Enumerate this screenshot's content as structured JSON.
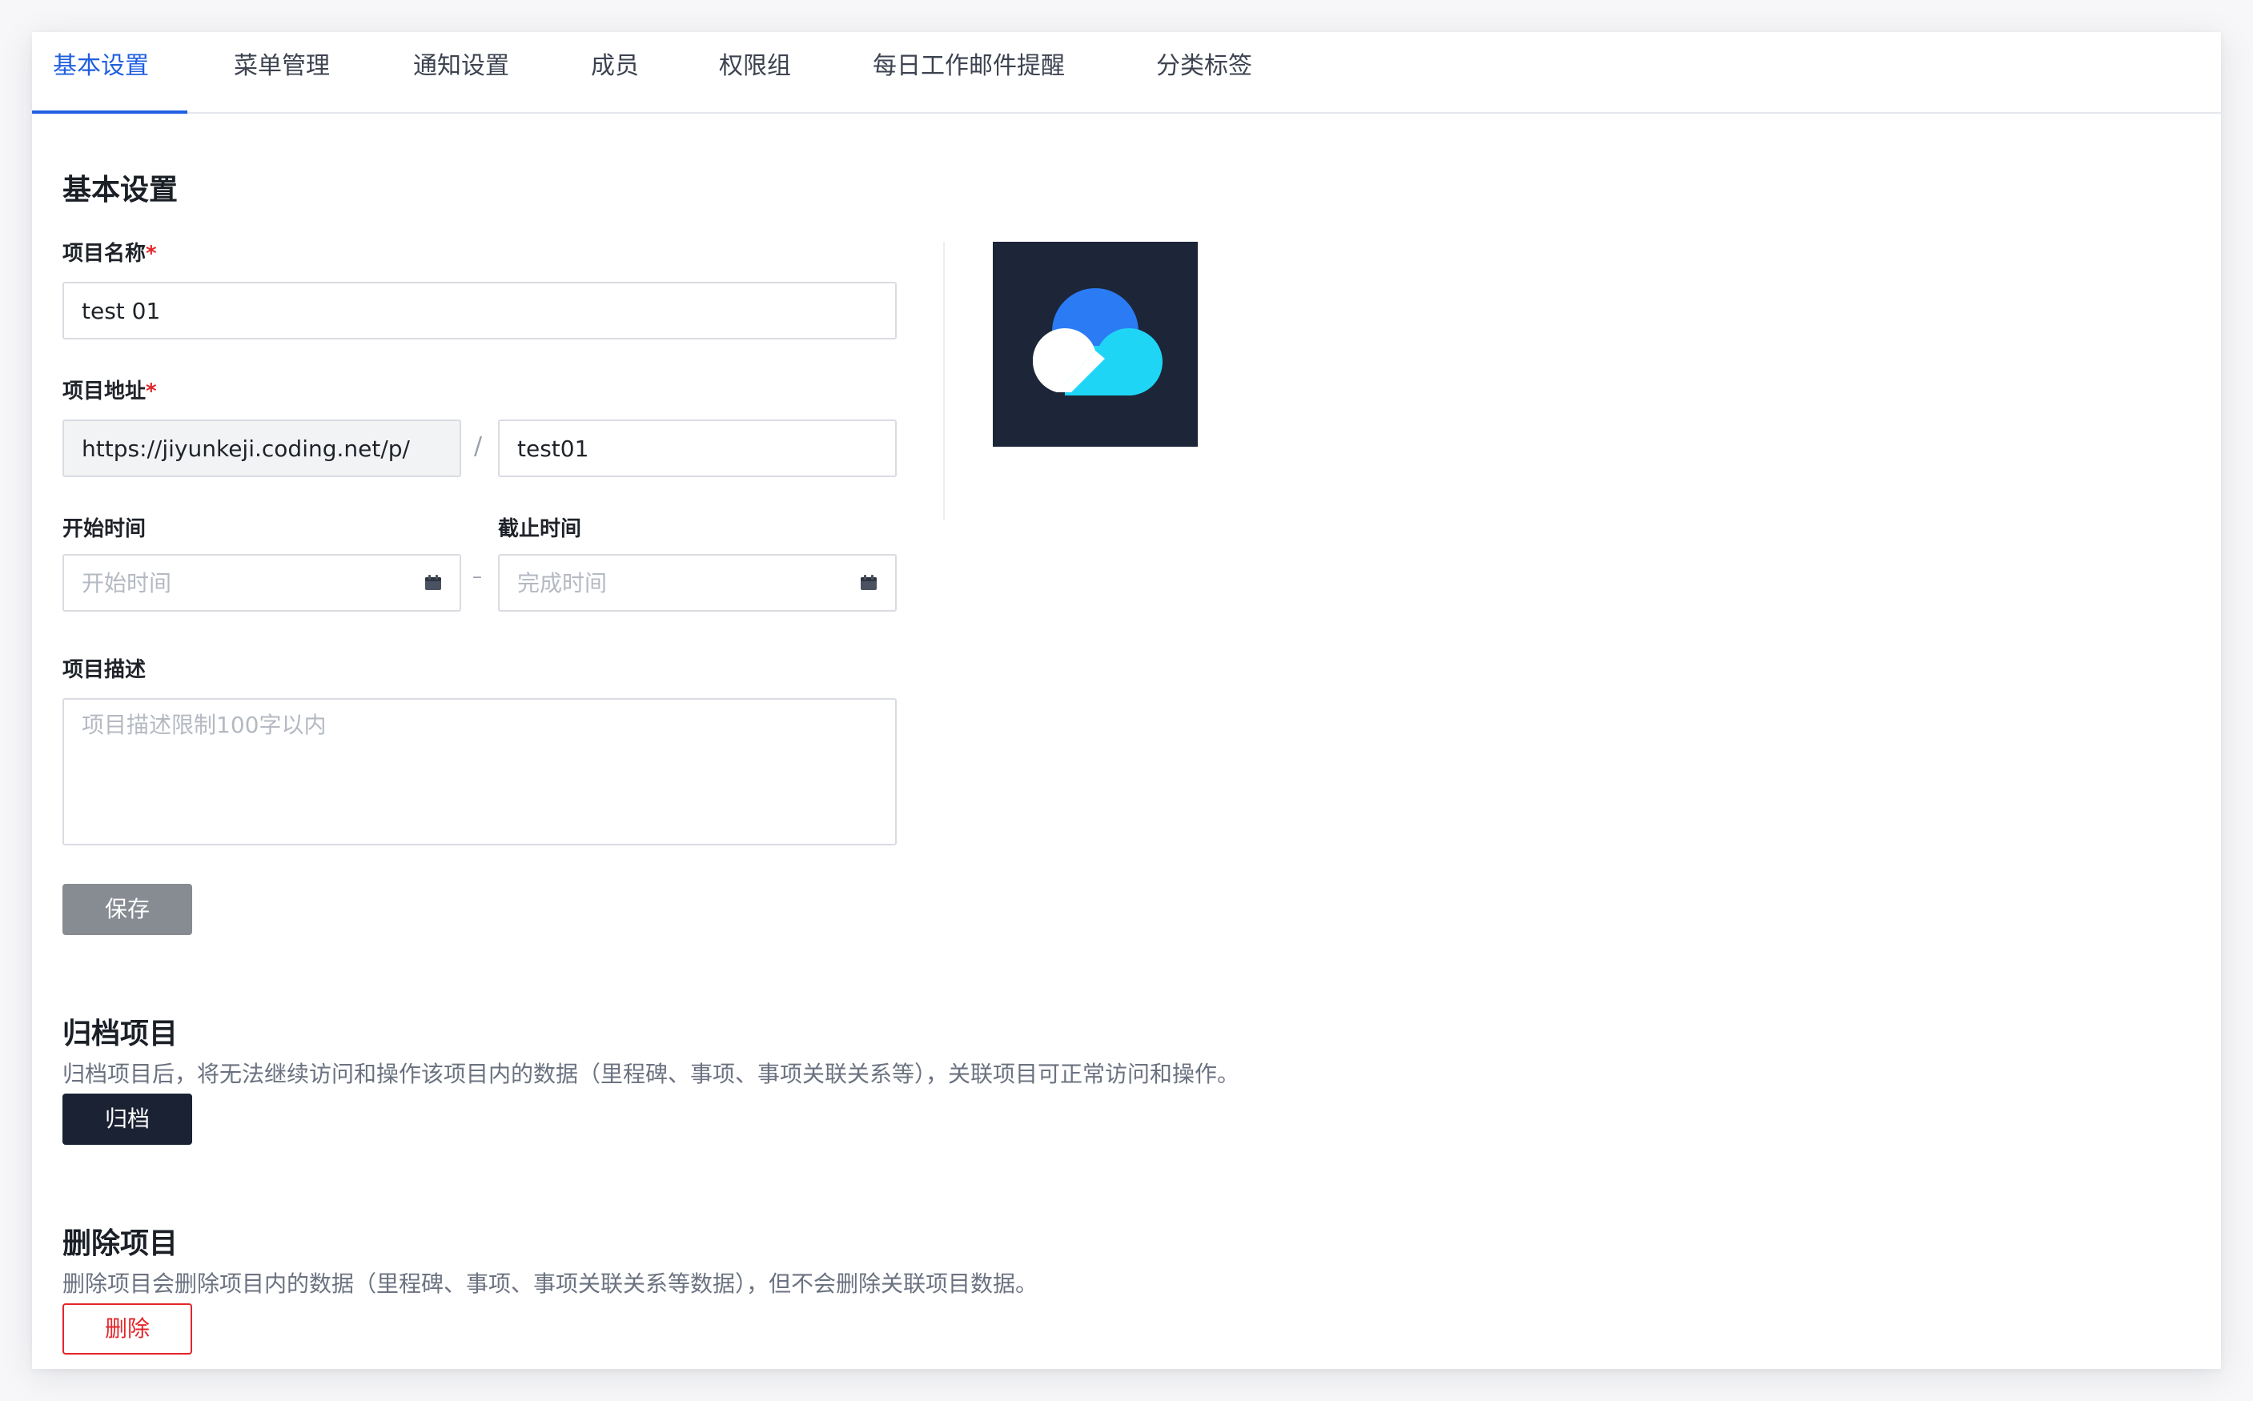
{
  "tabs": [
    {
      "label": "基本设置",
      "active": true
    },
    {
      "label": "菜单管理",
      "active": false
    },
    {
      "label": "通知设置",
      "active": false
    },
    {
      "label": "成员",
      "active": false
    },
    {
      "label": "权限组",
      "active": false
    },
    {
      "label": "每日工作邮件提醒",
      "active": false
    },
    {
      "label": "分类标签",
      "active": false
    }
  ],
  "basic": {
    "title": "基本设置",
    "project_name": {
      "label": "项目名称",
      "required_mark": "*",
      "value": "test 01"
    },
    "project_url": {
      "label": "项目地址",
      "required_mark": "*",
      "prefix": "https://jiyunkeji.coding.net/p/",
      "separator": "/",
      "value": "test01"
    },
    "start_time": {
      "label": "开始时间",
      "placeholder": "开始时间"
    },
    "range_separator": "–",
    "end_time": {
      "label": "截止时间",
      "placeholder": "完成时间"
    },
    "description": {
      "label": "项目描述",
      "placeholder": "项目描述限制100字以内"
    },
    "save_label": "保存"
  },
  "archive": {
    "title": "归档项目",
    "description": "归档项目后，将无法继续访问和操作该项目内的数据（里程碑、事项、事项关联关系等），关联项目可正常访问和操作。",
    "button_label": "归档"
  },
  "delete": {
    "title": "删除项目",
    "description": "删除项目会删除项目内的数据（里程碑、事项、事项关联关系等数据），但不会删除关联项目数据。",
    "button_label": "删除"
  },
  "colors": {
    "accent": "#1f5fe0",
    "danger": "#e5252a",
    "logo_bg": "#1c2638",
    "logo_cloud_blue": "#2b7bf5",
    "logo_cloud_cyan": "#1fd5f5"
  },
  "icons": {
    "date_picker": "calendar-icon",
    "project_logo": "cloud-logo"
  }
}
